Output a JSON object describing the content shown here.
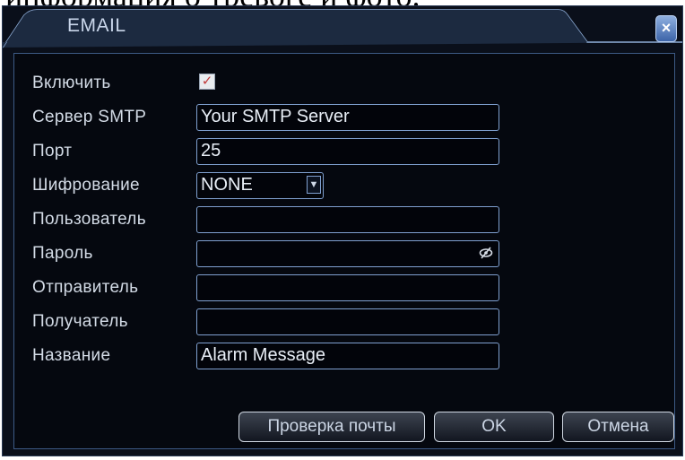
{
  "background_caption": "информация о тревоге и фото.",
  "window": {
    "title": "EMAIL",
    "close_label": "×"
  },
  "form": {
    "enable": {
      "label": "Включить",
      "checked": true,
      "check_mark": "✓"
    },
    "smtp_server": {
      "label": "Сервер SMTP",
      "value": "Your SMTP Server"
    },
    "port": {
      "label": "Порт",
      "value": "25"
    },
    "encryption": {
      "label": "Шифрование",
      "value": "NONE",
      "arrow": "▼"
    },
    "user": {
      "label": "Пользователь",
      "value": ""
    },
    "password": {
      "label": "Пароль",
      "value": ""
    },
    "sender": {
      "label": "Отправитель",
      "value": ""
    },
    "recipient": {
      "label": "Получатель",
      "value": ""
    },
    "subject": {
      "label": "Название",
      "value": "Alarm Message"
    }
  },
  "buttons": {
    "test_mail": "Проверка почты",
    "ok": "OK",
    "cancel": "Отмена"
  },
  "colors": {
    "window_bg": "#0a0f1a",
    "accent_border": "#7fa0d0",
    "text": "#d3dbe6",
    "check_mark": "#c23b3b",
    "close_button": "#3d64a8"
  }
}
